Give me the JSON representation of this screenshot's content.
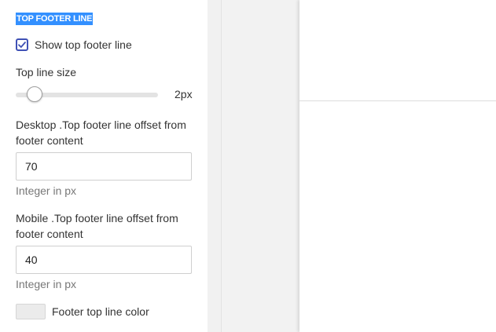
{
  "section": {
    "title": "TOP FOOTER LINE"
  },
  "show_line": {
    "label": "Show top footer line",
    "checked": true
  },
  "line_size": {
    "label": "Top line size",
    "value_text": "2px",
    "value": 2
  },
  "desktop_offset": {
    "label_line1": "Desktop .Top footer line offset from",
    "label_line2": "footer content",
    "value": "70",
    "hint": "Integer in px"
  },
  "mobile_offset": {
    "label_line1": "Mobile .Top footer line offset from",
    "label_line2": "footer content",
    "value": "40",
    "hint": "Integer in px"
  },
  "line_color": {
    "label": "Footer top line color",
    "swatch_color": "#ebebeb"
  },
  "colors": {
    "accent": "#3f51b5",
    "highlight": "#3390ff"
  }
}
